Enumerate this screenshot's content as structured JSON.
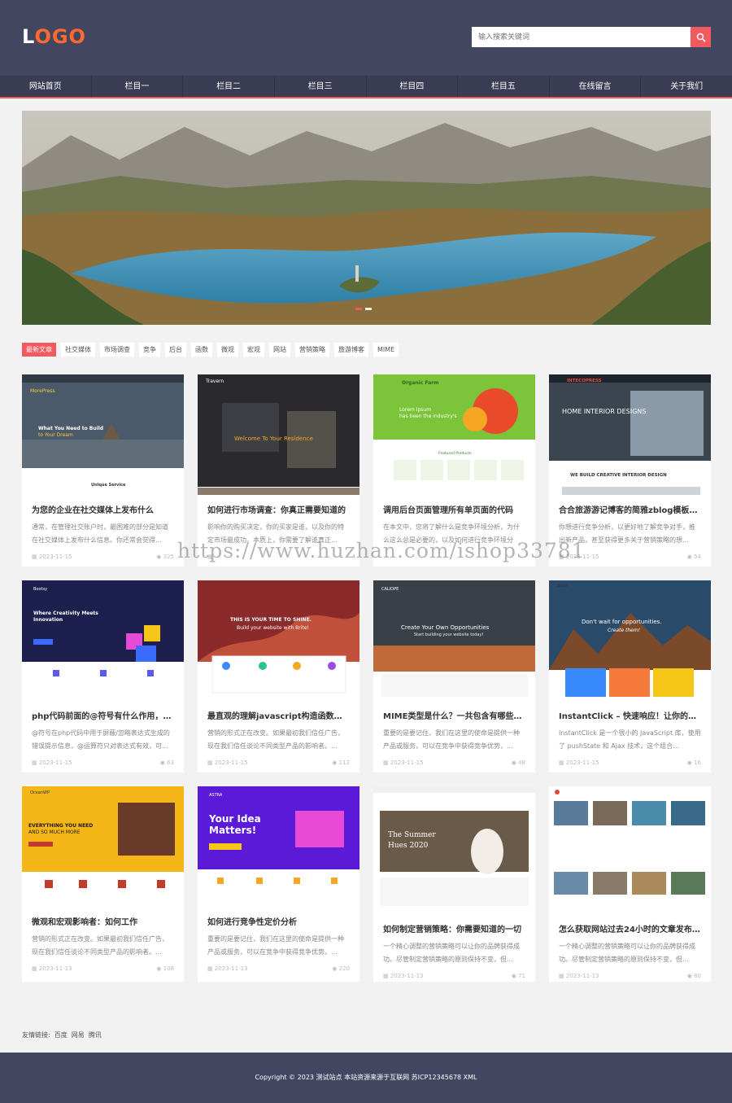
{
  "header": {
    "logo_text": "LOGO",
    "search_placeholder": "输入搜索关键词"
  },
  "nav": [
    "网站首页",
    "栏目一",
    "栏目二",
    "栏目三",
    "栏目四",
    "栏目五",
    "在线留言",
    "关于我们"
  ],
  "tags": [
    "最新文章",
    "社交媒体",
    "市场调查",
    "竞争",
    "后台",
    "函数",
    "微观",
    "宏观",
    "网站",
    "营销策略",
    "旅游博客",
    "MIME"
  ],
  "cards": [
    {
      "title": "为您的企业在社交媒体上发布什么",
      "desc": "通常，在管理社交账户时，最困难的部分是知道在社交媒体上发布什么信息。你还常会觉得…",
      "date": "2023-11-15",
      "views": "325",
      "thumb": {
        "logo": "MorePress",
        "headline": "What You Need to Build to Your Dream",
        "sub": "Unique Service"
      }
    },
    {
      "title": "如何进行市场调查：你真正需要知道的",
      "desc": "影响你的购买决定，你的买家是谁，以及你的特定市场最成功。本质上，你需要了解谁真正…",
      "date": "",
      "views": "",
      "thumb": {
        "logo": "Travern",
        "headline": "Welcome To Your Residence"
      }
    },
    {
      "title": "调用后台页面管理所有单页面的代码",
      "desc": "在本文中，您将了解什么是竞争环境分析，为什么这么总是必要的，以及如何进行竞争环境分析…",
      "date": "",
      "views": "",
      "thumb": {
        "logo": "Organic Farm",
        "headline": "Lorem Ipsum has been the industry's",
        "sub": "Featured Products"
      }
    },
    {
      "title": "合合旅游游记博客的简雅zblog模板主题",
      "desc": "你想进行竞争分析，以更好地了解竞争对手，推出新产品，甚至获得更多关于营销策略的想…",
      "date": "2023-11-15",
      "views": "54",
      "thumb": {
        "logo": "INTECOPRESS",
        "headline": "HOME INTERIOR DESIGNS",
        "sub": "WE BUILD CREATIVE INTERIOR DESIGN"
      }
    },
    {
      "title": "php代码前面的@符号有什么作用，@…",
      "desc": "@符号在php代码中用于屏蔽/忽略表达式生成的错误提示信息，@运算符只对表达式有效，可…",
      "date": "2023-11-15",
      "views": "63",
      "thumb": {
        "logo": "Bootsy",
        "headline": "Where Creativity Meets Innovation"
      }
    },
    {
      "title": "最直观的理解javascript构造函数和普…",
      "desc": "营销的形式正在改变。如果最初我们信任广告，现在我们信任谈论不同类型产品的影响者。…",
      "date": "2023-11-15",
      "views": "113",
      "thumb": {
        "headline": "THIS IS YOUR TIME TO SHINE.",
        "sub": "Build your website with Brite!"
      }
    },
    {
      "title": "MIME类型是什么？一共包含有哪些类…",
      "desc": "重要的是要记住，我们在这里的使命是提供一种产品或服务，可以在竞争中获得竞争优势，…",
      "date": "2023-11-15",
      "views": "48",
      "thumb": {
        "logo": "CALIOPE",
        "headline": "Create Your Own Opportunities",
        "sub": "Start building your website today!"
      }
    },
    {
      "title": "InstantClick – 快速响应！让你的网站…",
      "desc": "InstantClick 是一个很小的 JavaScript 库，使用了 pushState 和 Ajax 技术，这个组合…",
      "date": "2023-11-15",
      "views": "16",
      "thumb": {
        "logo": "Bona",
        "headline": "Don't wait for opportunities.",
        "sub": "Create them!"
      }
    },
    {
      "title": "微观和宏观影响者：如何工作",
      "desc": "营销的形式正在改变。如果最初我们信任广告，现在我们信任谈论不同类型产品的影响者。…",
      "date": "2023-11-13",
      "views": "108",
      "thumb": {
        "logo": "OceanWP",
        "headline": "EVERYTHING YOU NEED AND SO MUCH MORE"
      }
    },
    {
      "title": "如何进行竞争性定价分析",
      "desc": "重要的是要记住，我们在这里的使命是提供一种产品或服务，可以在竞争中获得竞争优势，…",
      "date": "2023-11-13",
      "views": "220",
      "thumb": {
        "logo": "ASTRA",
        "headline": "Your Idea Matters!"
      }
    },
    {
      "title": "如何制定营销策略：你需要知道的一切",
      "desc": "一个精心调整的营销策略可以让你的品牌获得成功。尽管制定营销策略的原则保持不变，但…",
      "date": "2023-11-13",
      "views": "71",
      "thumb": {
        "headline": "The Summer Hues 2020"
      }
    },
    {
      "title": "怎么获取网站过去24小时的文章发布数量",
      "desc": "一个精心调整的营销策略可以让你的品牌获得成功。尽管制定营销策略的原则保持不变，但…",
      "date": "2023-11-13",
      "views": "80",
      "thumb": {}
    }
  ],
  "links": {
    "label": "友情链接:",
    "items": [
      "百度",
      "网易",
      "腾讯"
    ]
  },
  "footer": {
    "text": "Copyright © 2023 测试站点 本站资源来源于互联网 苏ICP12345678 XML"
  },
  "watermark": "https://www.huzhan.com/ishop33781",
  "colors": {
    "header": "#434660",
    "nav": "#393c52",
    "accent": "#f15a5f"
  }
}
